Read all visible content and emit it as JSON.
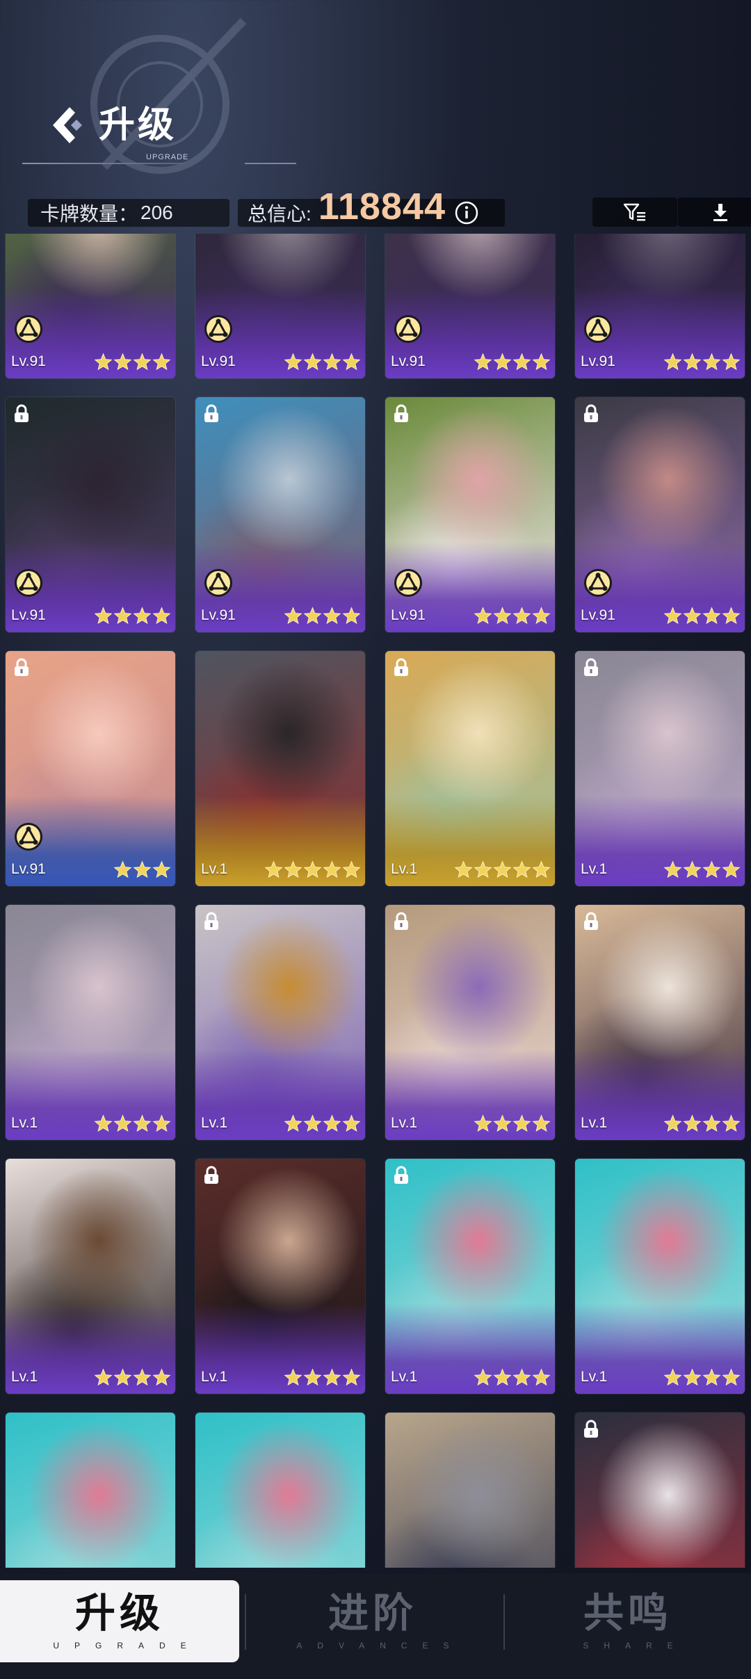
{
  "header": {
    "title": "升级",
    "subtitle": "UPGRADE"
  },
  "stats": {
    "card_count_label": "卡牌数量：",
    "card_count_value": "206",
    "total_label": "总信心:",
    "total_value": "118844"
  },
  "toolbar": {
    "filter_icon": "filter-icon",
    "download_icon": "download-icon"
  },
  "cards": [
    {
      "level": "Lv.91",
      "stars": 4,
      "locked": false,
      "badge": true,
      "frame": "purple",
      "art": "art-a"
    },
    {
      "level": "Lv.91",
      "stars": 4,
      "locked": false,
      "badge": true,
      "frame": "purple",
      "art": "art-b"
    },
    {
      "level": "Lv.91",
      "stars": 4,
      "locked": false,
      "badge": true,
      "frame": "purple",
      "art": "art-c"
    },
    {
      "level": "Lv.91",
      "stars": 4,
      "locked": false,
      "badge": true,
      "frame": "purple",
      "art": "art-d"
    },
    {
      "level": "Lv.91",
      "stars": 4,
      "locked": true,
      "badge": true,
      "frame": "purple",
      "art": "art-dark"
    },
    {
      "level": "Lv.91",
      "stars": 4,
      "locked": true,
      "badge": true,
      "frame": "purple",
      "art": "art-beach"
    },
    {
      "level": "Lv.91",
      "stars": 4,
      "locked": true,
      "badge": true,
      "frame": "purple",
      "art": "art-park"
    },
    {
      "level": "Lv.91",
      "stars": 4,
      "locked": true,
      "badge": true,
      "frame": "purple",
      "art": "art-cave"
    },
    {
      "level": "Lv.91",
      "stars": 3,
      "locked": true,
      "badge": true,
      "frame": "blue",
      "art": "art-peach"
    },
    {
      "level": "Lv.1",
      "stars": 5,
      "locked": false,
      "badge": false,
      "frame": "gold",
      "art": "art-bike"
    },
    {
      "level": "Lv.1",
      "stars": 5,
      "locked": true,
      "badge": false,
      "frame": "gold",
      "art": "art-window"
    },
    {
      "level": "Lv.1",
      "stars": 4,
      "locked": true,
      "badge": false,
      "frame": "purple",
      "art": "art-soft"
    },
    {
      "level": "Lv.1",
      "stars": 4,
      "locked": false,
      "badge": false,
      "frame": "purple",
      "art": "art-soft"
    },
    {
      "level": "Lv.1",
      "stars": 4,
      "locked": true,
      "badge": false,
      "frame": "purple",
      "art": "art-hoodie"
    },
    {
      "level": "Lv.1",
      "stars": 4,
      "locked": true,
      "badge": false,
      "frame": "purple",
      "art": "art-sofa"
    },
    {
      "level": "Lv.1",
      "stars": 4,
      "locked": true,
      "badge": false,
      "frame": "purple",
      "art": "art-sunny"
    },
    {
      "level": "Lv.1",
      "stars": 4,
      "locked": false,
      "badge": false,
      "frame": "purple",
      "art": "art-bed"
    },
    {
      "level": "Lv.1",
      "stars": 4,
      "locked": true,
      "badge": false,
      "frame": "purple",
      "art": "art-dance"
    },
    {
      "level": "Lv.1",
      "stars": 4,
      "locked": true,
      "badge": false,
      "frame": "purple",
      "art": "art-pool"
    },
    {
      "level": "Lv.1",
      "stars": 4,
      "locked": false,
      "badge": false,
      "frame": "purple",
      "art": "art-pool"
    },
    {
      "level": "",
      "stars": 0,
      "locked": false,
      "badge": false,
      "frame": "none",
      "art": "art-pool"
    },
    {
      "level": "",
      "stars": 0,
      "locked": false,
      "badge": false,
      "frame": "none",
      "art": "art-pool"
    },
    {
      "level": "",
      "stars": 0,
      "locked": false,
      "badge": false,
      "frame": "none",
      "art": "art-grey"
    },
    {
      "level": "",
      "stars": 0,
      "locked": true,
      "badge": false,
      "frame": "none",
      "art": "art-night"
    }
  ],
  "art_colors": {
    "art-a": [
      "#5a7a3c",
      "#c9b2a4",
      "#3b2b55"
    ],
    "art-b": [
      "#2a2732",
      "#8d8490",
      "#3b2b55"
    ],
    "art-c": [
      "#3e3445",
      "#b29fa9",
      "#3b2b55"
    ],
    "art-d": [
      "#1d1b26",
      "#6d6478",
      "#3b2b55"
    ],
    "art-dark": [
      "#1f2a2c",
      "#2d2433",
      "#4b3a5e"
    ],
    "art-beach": [
      "#3e8fbd",
      "#b8c6d3",
      "#7a5e6e"
    ],
    "art-park": [
      "#6a8a3a",
      "#e0a3a7",
      "#efe6e8"
    ],
    "art-cave": [
      "#3b3a44",
      "#c28a86",
      "#8d6aa6"
    ],
    "art-peach": [
      "#e8a387",
      "#f6c9bd",
      "#c58c92"
    ],
    "art-bike": [
      "#4f5560",
      "#2a2628",
      "#8a2f2f"
    ],
    "art-window": [
      "#d9a955",
      "#f0e0b8",
      "#9ec0a0"
    ],
    "art-soft": [
      "#8a8794",
      "#d8c3cd",
      "#b8a4c4"
    ],
    "art-hoodie": [
      "#c9c4c6",
      "#c78d34",
      "#7f67b3"
    ],
    "art-sofa": [
      "#b59a7c",
      "#8c6bb8",
      "#e8d4d0"
    ],
    "art-sunny": [
      "#d8b998",
      "#ece3d9",
      "#443545"
    ],
    "art-bed": [
      "#e8dedb",
      "#6a4a34",
      "#2d2522"
    ],
    "art-dance": [
      "#5a2d2a",
      "#c9a690",
      "#1b1619"
    ],
    "art-pool": [
      "#2fc0c7",
      "#e27a94",
      "#9bd9da"
    ],
    "art-grey": [
      "#b8a58b",
      "#8e8e99",
      "#3b3f55"
    ],
    "art-night": [
      "#2a2f3e",
      "#e8e2e6",
      "#a03241"
    ]
  },
  "tabs": [
    {
      "label": "升级",
      "sub": "UPGRADE",
      "active": true
    },
    {
      "label": "进阶",
      "sub": "ADVANCES",
      "active": false
    },
    {
      "label": "共鸣",
      "sub": "SHARE",
      "active": false
    }
  ],
  "colors": {
    "total_value": "#f5c9a3",
    "star": "#f2d35b",
    "frame_purple": "#6a3dc4",
    "frame_gold": "#c9a12c",
    "frame_blue": "#3556b8"
  }
}
